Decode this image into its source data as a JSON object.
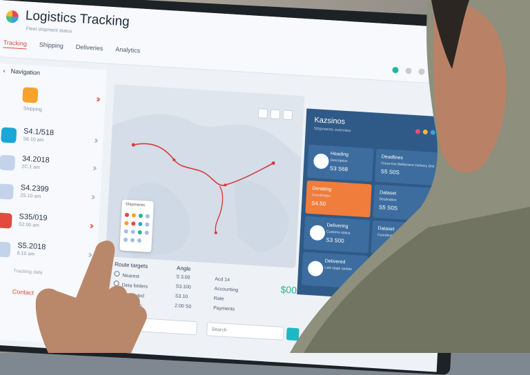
{
  "app": {
    "title": "Logistics Tracking",
    "subtitle": "Fleet shipment status"
  },
  "tabs": [
    {
      "label": "Tracking",
      "active": true
    },
    {
      "label": "Shipping",
      "active": false
    },
    {
      "label": "Deliveries",
      "active": false
    },
    {
      "label": "Analytics",
      "active": false
    }
  ],
  "left": {
    "header": "Navigation",
    "items": [
      {
        "value": "",
        "sub": "Shipping",
        "icon": "box-icon",
        "color": "#f6a22b",
        "chev": "red"
      },
      {
        "value": "S4.1/518",
        "sub": "S6.10 am",
        "icon": "truck-icon",
        "color": "#1aa7d6",
        "chev": "blue"
      },
      {
        "value": "34.2018",
        "sub": "2C.1 am",
        "icon": "ship-icon",
        "color": "#a3bde0",
        "chev": "blue"
      },
      {
        "value": "S4.2399",
        "sub": "2S.10 am",
        "icon": "plane-icon",
        "color": "#a3bde0",
        "chev": "blue"
      },
      {
        "value": "S35/019",
        "sub": "S2.00 am",
        "icon": "flag-icon",
        "color": "#e34a3f",
        "chev": "red"
      },
      {
        "value": "S5.2018",
        "sub": "6.10 am",
        "icon": "warehouse-icon",
        "color": "#a3bde0",
        "chev": "blue"
      }
    ],
    "footer_note": "Tracking data",
    "footer_button": "Contact"
  },
  "map": {
    "legend_title": "Shipments",
    "route_color": "#d93a3a"
  },
  "stats": {
    "col1_header": "Route targets",
    "col2_header": "Angle",
    "rows": [
      {
        "name": "Nearest",
        "a": "S 3.00",
        "b": "Acd 14"
      },
      {
        "name": "Deta folders",
        "a": "S3.100",
        "b": "Accounting"
      },
      {
        "name": "Scheduled",
        "a": "S3.10",
        "b": "Rate"
      },
      {
        "name": "Overdues",
        "a": "2.00 S0",
        "b": "Payments"
      }
    ],
    "highlight": "$00"
  },
  "inputs": {
    "left_placeholder": "Library",
    "right_placeholder": "Search"
  },
  "right": {
    "title": "Kazsinos",
    "sub": "Shipments overview",
    "dot_colors": [
      "#e94b7b",
      "#f6b73c",
      "#3aa0e0"
    ],
    "cards": [
      {
        "title": "Heading",
        "desc": "Description",
        "value": "S3 S68",
        "icon": "plane-icon",
        "orange": false
      },
      {
        "title": "Deadlines",
        "desc": "Cross-line Bellarmine Delivery Dist",
        "value": "S5 S0S",
        "orange": false
      },
      {
        "title": "Donating",
        "desc": "Coordinates",
        "value": "S4.50",
        "icon": "truck-icon",
        "orange": true
      },
      {
        "title": "Dataset",
        "desc": "Destination",
        "value": "S5 S0S",
        "orange": false
      },
      {
        "title": "Delivering",
        "desc": "Customs status",
        "value": "S3 S00",
        "icon": "ship-icon",
        "orange": false
      },
      {
        "title": "Dataset",
        "desc": "Coordination payment",
        "value": "",
        "orange": false
      },
      {
        "title": "Delivered",
        "desc": "Last stage update",
        "value": "",
        "icon": "pin-icon",
        "orange": false
      }
    ]
  }
}
